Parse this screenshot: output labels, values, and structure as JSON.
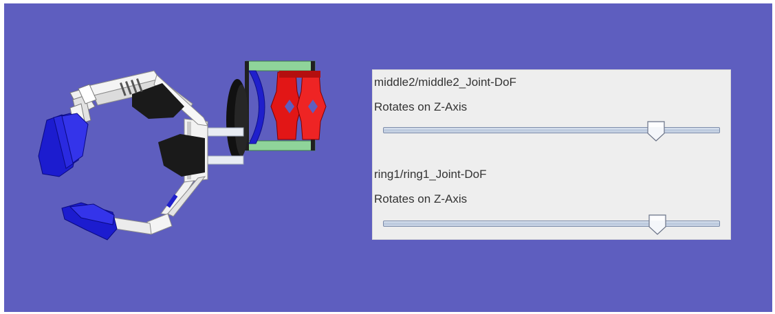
{
  "colors": {
    "viewport_bg": "#5e5ebf",
    "panel_bg": "#eeeeee"
  },
  "controls": [
    {
      "title": "middle2/middle2_Joint-DoF",
      "axis": "Rotates on Z-Axis",
      "value_fraction": 0.81
    },
    {
      "title": "ring1/ring1_Joint-DoF",
      "axis": "Rotates on Z-Axis",
      "value_fraction": 0.815
    }
  ]
}
